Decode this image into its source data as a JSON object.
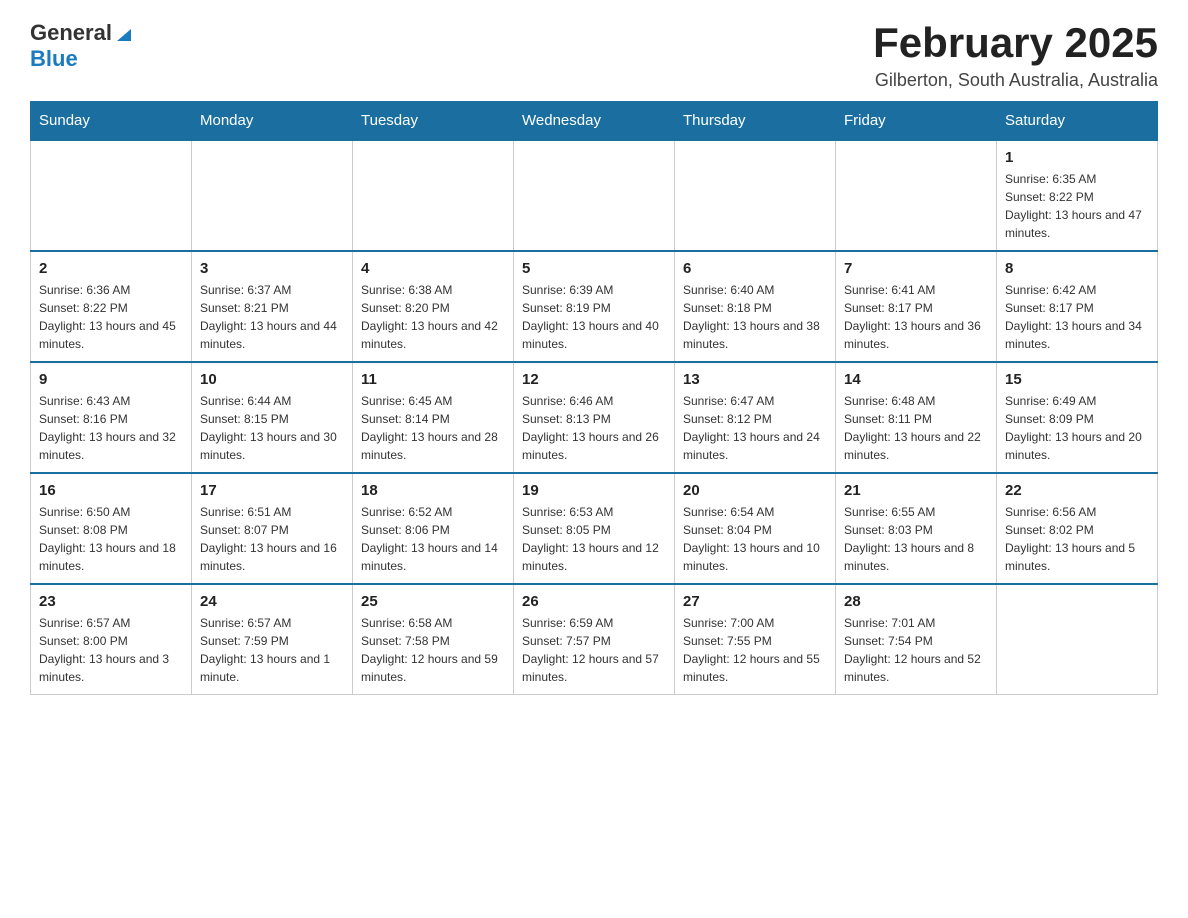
{
  "header": {
    "logo": {
      "general": "General",
      "blue": "Blue"
    },
    "title": "February 2025",
    "subtitle": "Gilberton, South Australia, Australia"
  },
  "weekdays": [
    "Sunday",
    "Monday",
    "Tuesday",
    "Wednesday",
    "Thursday",
    "Friday",
    "Saturday"
  ],
  "weeks": [
    [
      {
        "day": "",
        "info": ""
      },
      {
        "day": "",
        "info": ""
      },
      {
        "day": "",
        "info": ""
      },
      {
        "day": "",
        "info": ""
      },
      {
        "day": "",
        "info": ""
      },
      {
        "day": "",
        "info": ""
      },
      {
        "day": "1",
        "info": "Sunrise: 6:35 AM\nSunset: 8:22 PM\nDaylight: 13 hours and 47 minutes."
      }
    ],
    [
      {
        "day": "2",
        "info": "Sunrise: 6:36 AM\nSunset: 8:22 PM\nDaylight: 13 hours and 45 minutes."
      },
      {
        "day": "3",
        "info": "Sunrise: 6:37 AM\nSunset: 8:21 PM\nDaylight: 13 hours and 44 minutes."
      },
      {
        "day": "4",
        "info": "Sunrise: 6:38 AM\nSunset: 8:20 PM\nDaylight: 13 hours and 42 minutes."
      },
      {
        "day": "5",
        "info": "Sunrise: 6:39 AM\nSunset: 8:19 PM\nDaylight: 13 hours and 40 minutes."
      },
      {
        "day": "6",
        "info": "Sunrise: 6:40 AM\nSunset: 8:18 PM\nDaylight: 13 hours and 38 minutes."
      },
      {
        "day": "7",
        "info": "Sunrise: 6:41 AM\nSunset: 8:17 PM\nDaylight: 13 hours and 36 minutes."
      },
      {
        "day": "8",
        "info": "Sunrise: 6:42 AM\nSunset: 8:17 PM\nDaylight: 13 hours and 34 minutes."
      }
    ],
    [
      {
        "day": "9",
        "info": "Sunrise: 6:43 AM\nSunset: 8:16 PM\nDaylight: 13 hours and 32 minutes."
      },
      {
        "day": "10",
        "info": "Sunrise: 6:44 AM\nSunset: 8:15 PM\nDaylight: 13 hours and 30 minutes."
      },
      {
        "day": "11",
        "info": "Sunrise: 6:45 AM\nSunset: 8:14 PM\nDaylight: 13 hours and 28 minutes."
      },
      {
        "day": "12",
        "info": "Sunrise: 6:46 AM\nSunset: 8:13 PM\nDaylight: 13 hours and 26 minutes."
      },
      {
        "day": "13",
        "info": "Sunrise: 6:47 AM\nSunset: 8:12 PM\nDaylight: 13 hours and 24 minutes."
      },
      {
        "day": "14",
        "info": "Sunrise: 6:48 AM\nSunset: 8:11 PM\nDaylight: 13 hours and 22 minutes."
      },
      {
        "day": "15",
        "info": "Sunrise: 6:49 AM\nSunset: 8:09 PM\nDaylight: 13 hours and 20 minutes."
      }
    ],
    [
      {
        "day": "16",
        "info": "Sunrise: 6:50 AM\nSunset: 8:08 PM\nDaylight: 13 hours and 18 minutes."
      },
      {
        "day": "17",
        "info": "Sunrise: 6:51 AM\nSunset: 8:07 PM\nDaylight: 13 hours and 16 minutes."
      },
      {
        "day": "18",
        "info": "Sunrise: 6:52 AM\nSunset: 8:06 PM\nDaylight: 13 hours and 14 minutes."
      },
      {
        "day": "19",
        "info": "Sunrise: 6:53 AM\nSunset: 8:05 PM\nDaylight: 13 hours and 12 minutes."
      },
      {
        "day": "20",
        "info": "Sunrise: 6:54 AM\nSunset: 8:04 PM\nDaylight: 13 hours and 10 minutes."
      },
      {
        "day": "21",
        "info": "Sunrise: 6:55 AM\nSunset: 8:03 PM\nDaylight: 13 hours and 8 minutes."
      },
      {
        "day": "22",
        "info": "Sunrise: 6:56 AM\nSunset: 8:02 PM\nDaylight: 13 hours and 5 minutes."
      }
    ],
    [
      {
        "day": "23",
        "info": "Sunrise: 6:57 AM\nSunset: 8:00 PM\nDaylight: 13 hours and 3 minutes."
      },
      {
        "day": "24",
        "info": "Sunrise: 6:57 AM\nSunset: 7:59 PM\nDaylight: 13 hours and 1 minute."
      },
      {
        "day": "25",
        "info": "Sunrise: 6:58 AM\nSunset: 7:58 PM\nDaylight: 12 hours and 59 minutes."
      },
      {
        "day": "26",
        "info": "Sunrise: 6:59 AM\nSunset: 7:57 PM\nDaylight: 12 hours and 57 minutes."
      },
      {
        "day": "27",
        "info": "Sunrise: 7:00 AM\nSunset: 7:55 PM\nDaylight: 12 hours and 55 minutes."
      },
      {
        "day": "28",
        "info": "Sunrise: 7:01 AM\nSunset: 7:54 PM\nDaylight: 12 hours and 52 minutes."
      },
      {
        "day": "",
        "info": ""
      }
    ]
  ]
}
